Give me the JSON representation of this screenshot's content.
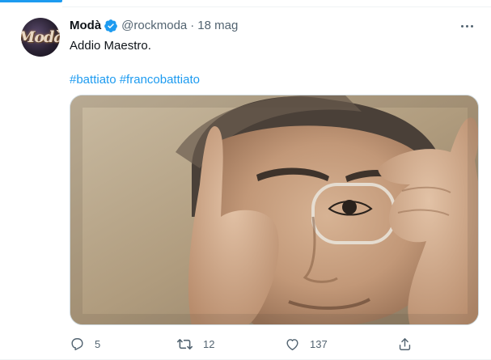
{
  "tweet": {
    "author_name": "Modà",
    "handle": "@rockmoda",
    "separator": "·",
    "date": "18 mag",
    "text": "Addio Maestro.",
    "hashtags": [
      "#battiato",
      "#francobattiato"
    ],
    "avatar_text": "Modà"
  },
  "actions": {
    "reply_count": "5",
    "retweet_count": "12",
    "like_count": "137"
  },
  "colors": {
    "accent": "#1d9bf0",
    "secondary_text": "#536471",
    "primary_text": "#0f1419"
  },
  "icons": [
    "verified-badge-icon",
    "more-icon",
    "reply-icon",
    "retweet-icon",
    "like-icon",
    "share-icon"
  ]
}
